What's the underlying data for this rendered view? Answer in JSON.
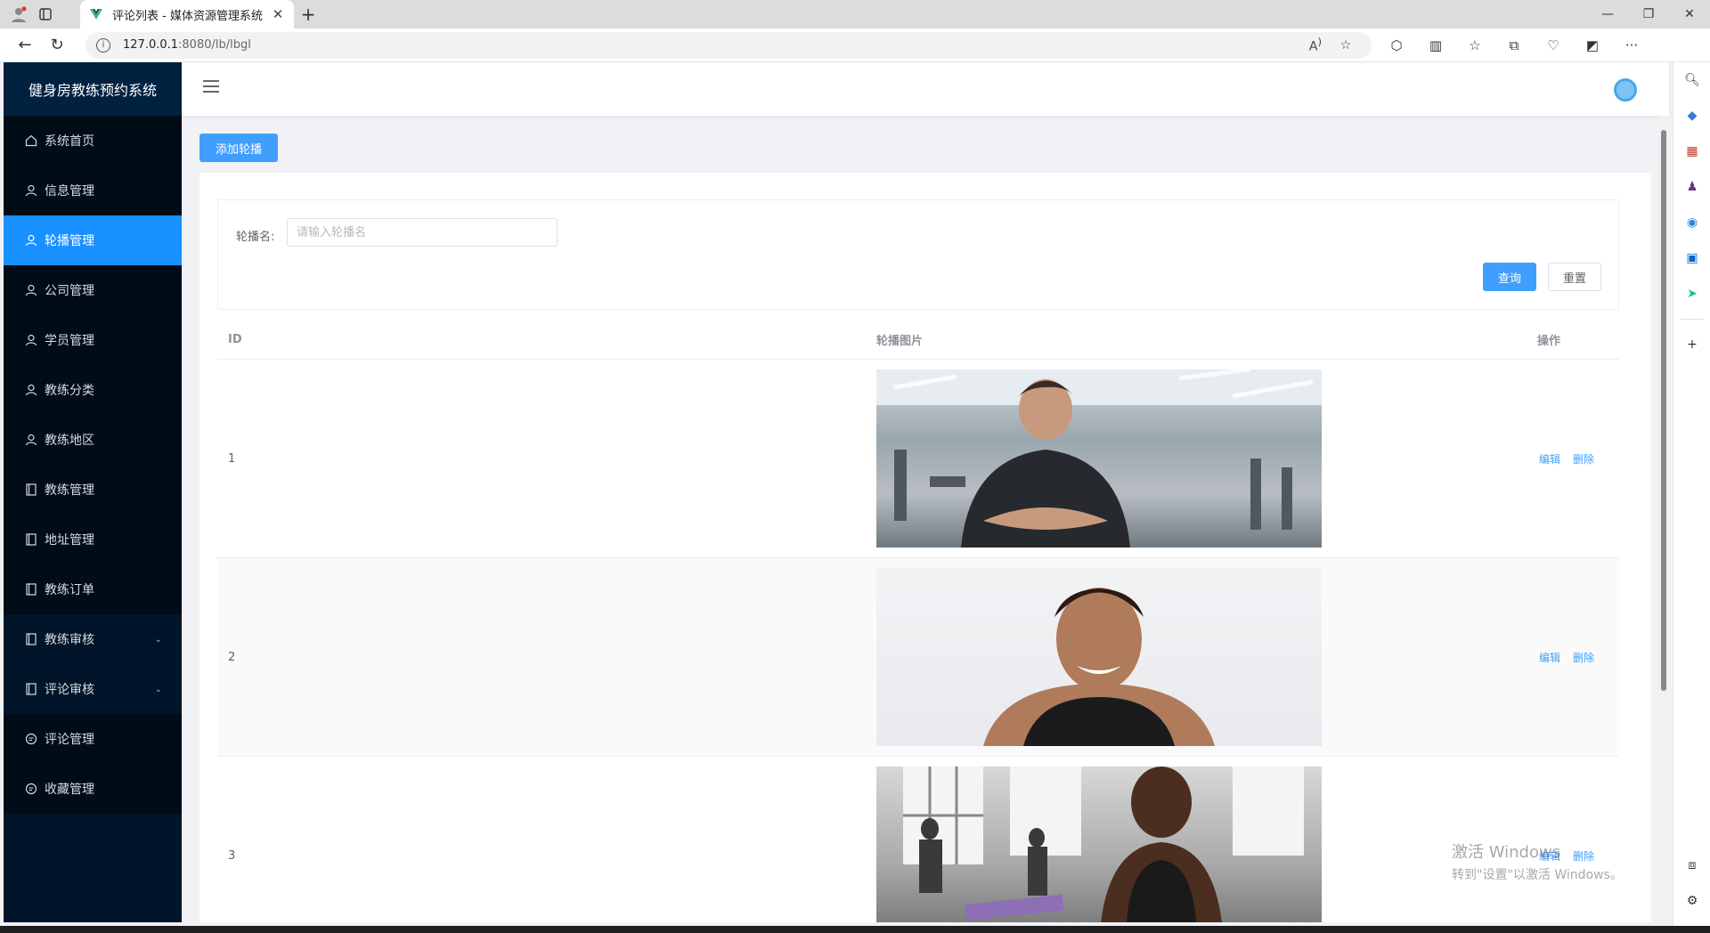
{
  "browser": {
    "tab_title": "评论列表 - 媒体资源管理系统",
    "url_host": "127.0.0.1",
    "url_rest": ":8080/lb/lbgl"
  },
  "app": {
    "brand": "健身房教练预约系统",
    "menu": [
      {
        "label": "系统首页",
        "icon": "home-icon"
      },
      {
        "label": "信息管理",
        "icon": "user-icon"
      },
      {
        "label": "轮播管理",
        "icon": "user-icon",
        "active": true
      },
      {
        "label": "公司管理",
        "icon": "user-icon"
      },
      {
        "label": "学员管理",
        "icon": "user-icon"
      },
      {
        "label": "教练分类",
        "icon": "user-icon"
      },
      {
        "label": "教练地区",
        "icon": "user-icon"
      },
      {
        "label": "教练管理",
        "icon": "document-icon"
      },
      {
        "label": "地址管理",
        "icon": "document-icon"
      },
      {
        "label": "教练订单",
        "icon": "document-icon"
      },
      {
        "label": "教练审核",
        "icon": "document-icon",
        "submenu": true
      },
      {
        "label": "评论审核",
        "icon": "document-icon",
        "submenu": true
      },
      {
        "label": "评论管理",
        "icon": "chat-icon"
      },
      {
        "label": "收藏管理",
        "icon": "chat-icon"
      }
    ]
  },
  "page": {
    "add_button": "添加轮播",
    "search": {
      "label": "轮播名:",
      "placeholder": "请输入轮播名",
      "query_button": "查询",
      "reset_button": "重置"
    },
    "table": {
      "headers": [
        "ID",
        "轮播图片",
        "操作"
      ],
      "rows": [
        {
          "id": "1",
          "edit": "编辑",
          "delete": "删除"
        },
        {
          "id": "2",
          "edit": "编辑",
          "delete": "删除"
        },
        {
          "id": "3",
          "edit": "编辑",
          "delete": "删除"
        }
      ]
    }
  },
  "os": {
    "watermark_line1": "激活 Windows",
    "watermark_line2": "转到\"设置\"以激活 Windows。"
  },
  "colors": {
    "sidebar_bg": "#001529",
    "active": "#1890ff",
    "primary": "#409eff"
  }
}
